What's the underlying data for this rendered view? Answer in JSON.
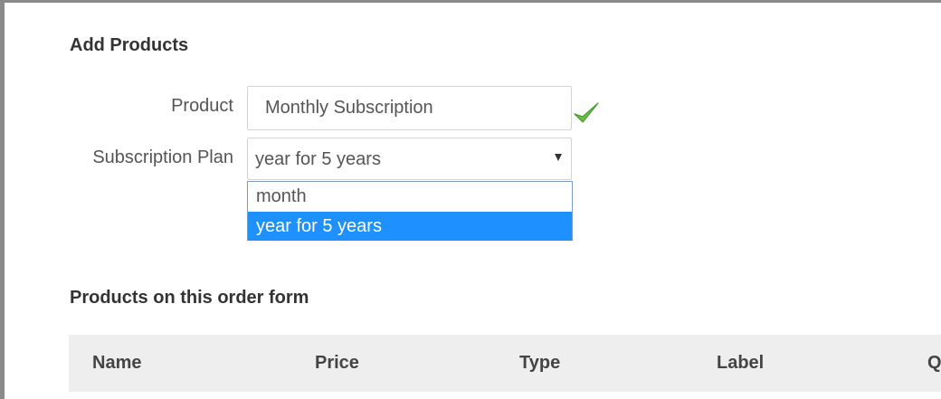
{
  "add_products": {
    "title": "Add Products",
    "product_label": "Product",
    "product_value": "Monthly Subscription",
    "plan_label": "Subscription Plan",
    "plan_selected": "year for 5 years",
    "plan_options": [
      "month",
      "year for 5 years"
    ],
    "valid_icon": "check-icon",
    "valid_color": "#5cb85c"
  },
  "products_table": {
    "title": "Products on this order form",
    "columns": [
      "Name",
      "Price",
      "Type",
      "Label",
      "Q"
    ]
  },
  "colors": {
    "highlight": "#1e90ff",
    "header_bg": "#eeeeee"
  }
}
